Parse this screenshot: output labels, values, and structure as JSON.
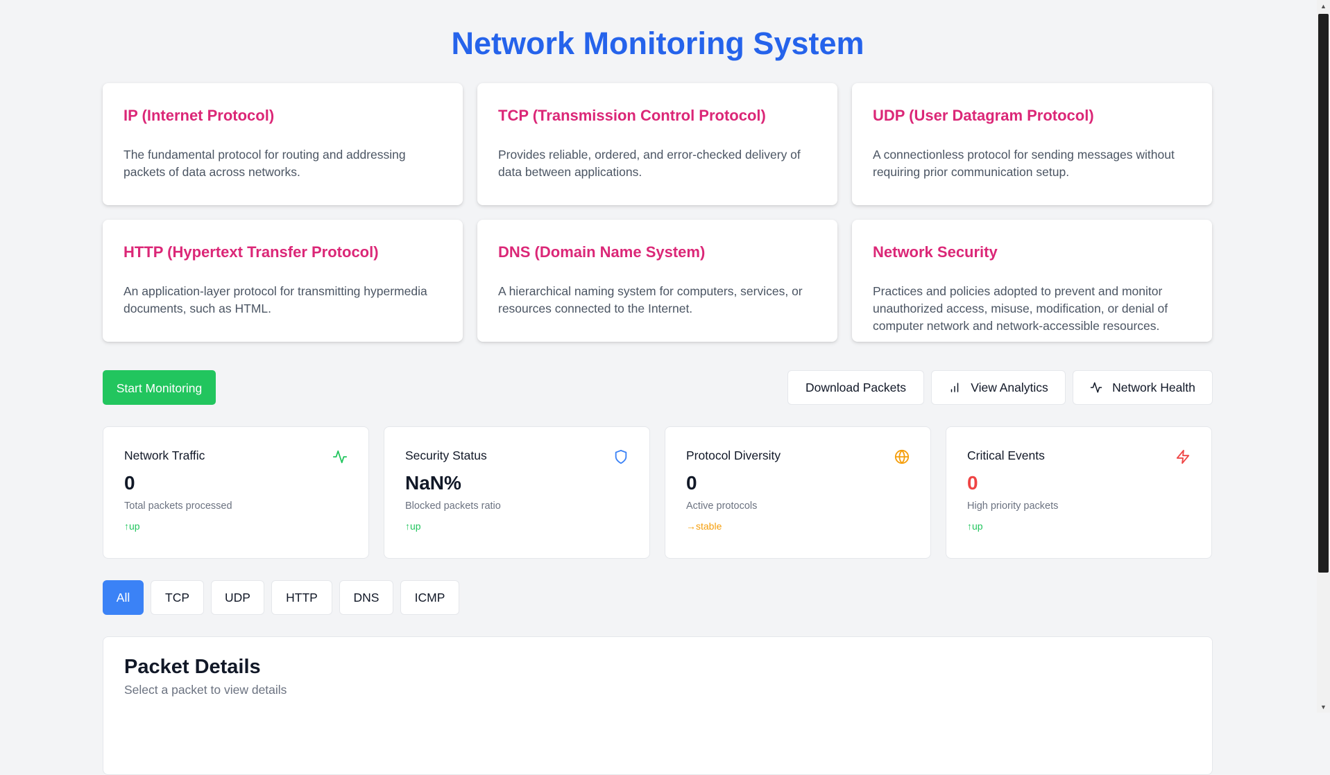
{
  "title": "Network Monitoring System",
  "protocols": [
    {
      "title": "IP (Internet Protocol)",
      "desc": "The fundamental protocol for routing and addressing packets of data across networks."
    },
    {
      "title": "TCP (Transmission Control Protocol)",
      "desc": "Provides reliable, ordered, and error-checked delivery of data between applications."
    },
    {
      "title": "UDP (User Datagram Protocol)",
      "desc": "A connectionless protocol for sending messages without requiring prior communication setup."
    },
    {
      "title": "HTTP (Hypertext Transfer Protocol)",
      "desc": "An application-layer protocol for transmitting hypermedia documents, such as HTML."
    },
    {
      "title": "DNS (Domain Name System)",
      "desc": "A hierarchical naming system for computers, services, or resources connected to the Internet."
    },
    {
      "title": "Network Security",
      "desc": "Practices and policies adopted to prevent and monitor unauthorized access, misuse, modification, or denial of computer network and network-accessible resources."
    }
  ],
  "actions": {
    "start": "Start Monitoring",
    "download": "Download Packets",
    "analytics": "View Analytics",
    "health": "Network Health"
  },
  "stats": [
    {
      "label": "Network Traffic",
      "value": "0",
      "sub": "Total packets processed",
      "trend": "↑up",
      "icon": "activity-icon",
      "color": "#22c55e"
    },
    {
      "label": "Security Status",
      "value": "NaN%",
      "sub": "Blocked packets ratio",
      "trend": "↑up",
      "icon": "shield-icon",
      "color": "#3b82f6"
    },
    {
      "label": "Protocol Diversity",
      "value": "0",
      "sub": "Active protocols",
      "trend": "→stable",
      "icon": "globe-icon",
      "color": "#f59e0b"
    },
    {
      "label": "Critical Events",
      "value": "0",
      "sub": "High priority packets",
      "trend": "↑up",
      "icon": "zap-icon",
      "color": "#ef4444"
    }
  ],
  "filters": [
    "All",
    "TCP",
    "UDP",
    "HTTP",
    "DNS",
    "ICMP"
  ],
  "active_filter": "All",
  "details": {
    "title": "Packet Details",
    "subtitle": "Select a packet to view details"
  },
  "colors": {
    "accent": "#2563eb",
    "protocol_title": "#db2777",
    "start_button": "#22c55e",
    "active_filter": "#3b82f6"
  }
}
